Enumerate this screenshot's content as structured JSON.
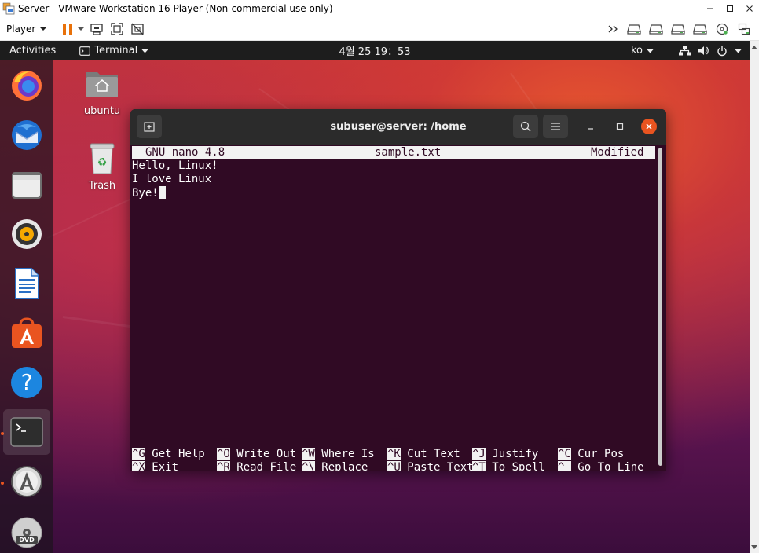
{
  "vm": {
    "title": "Server - VMware Workstation 16 Player (Non-commercial use only)",
    "player_menu": "Player",
    "colors": {
      "pause_accent": "#e8710a",
      "ubuntu_orange": "#e95420",
      "terminal_bg": "#300a24"
    }
  },
  "topbar": {
    "activities": "Activities",
    "app_menu": "Terminal",
    "clock": "4월 25  19：53",
    "input_method": "ko"
  },
  "dock": {
    "items": [
      "firefox-icon",
      "thunderbird-icon",
      "files-icon",
      "rhythmbox-icon",
      "libreoffice-writer-icon",
      "ubuntu-software-icon",
      "help-icon",
      "terminal-icon",
      "software-updater-icon",
      "dvd-icon"
    ]
  },
  "desktop": {
    "icons": [
      {
        "label": "ubuntu",
        "icon": "home-folder-icon"
      },
      {
        "label": "Trash",
        "icon": "trash-icon"
      }
    ]
  },
  "terminal": {
    "title": "subuser@server: /home",
    "nano": {
      "version": "GNU nano 4.8",
      "filename": "sample.txt",
      "status": "Modified",
      "lines": [
        "Hello, Linux!",
        "I love Linux",
        "Bye!"
      ],
      "shortcuts": [
        {
          "key": "^G",
          "label": "Get Help"
        },
        {
          "key": "^O",
          "label": "Write Out"
        },
        {
          "key": "^W",
          "label": "Where Is"
        },
        {
          "key": "^K",
          "label": "Cut Text"
        },
        {
          "key": "^J",
          "label": "Justify"
        },
        {
          "key": "^C",
          "label": "Cur Pos"
        },
        {
          "key": "^X",
          "label": "Exit"
        },
        {
          "key": "^R",
          "label": "Read File"
        },
        {
          "key": "^\\",
          "label": "Replace"
        },
        {
          "key": "^U",
          "label": "Paste Text"
        },
        {
          "key": "^T",
          "label": "To Spell"
        },
        {
          "key": "^_",
          "label": "Go To Line"
        }
      ]
    }
  }
}
